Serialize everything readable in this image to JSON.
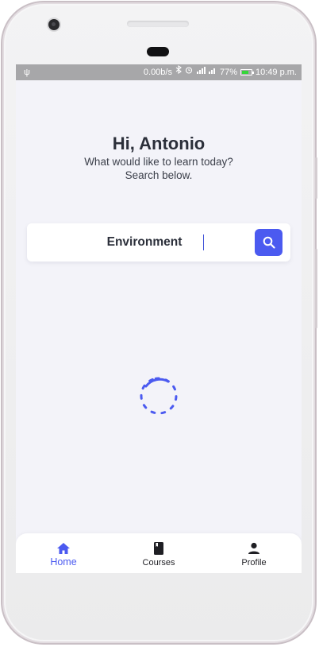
{
  "status_bar": {
    "usb_icon": "usb-icon",
    "network_speed": "0.00b/s",
    "battery_percent": "77%",
    "battery_level": 0.77,
    "battery_color": "#35d63a",
    "time": "10:49 p.m."
  },
  "header": {
    "greeting": "Hi, Antonio",
    "subtitle": "What would like to learn today? Search below."
  },
  "search": {
    "value": "Environment",
    "placeholder": "",
    "button_icon": "search-icon"
  },
  "loading": {
    "spinner_icon": "loading-spinner-icon"
  },
  "bottom_nav": {
    "items": [
      {
        "label": "Home",
        "icon": "home-icon",
        "active": true
      },
      {
        "label": "Courses",
        "icon": "book-icon",
        "active": false
      },
      {
        "label": "Profile",
        "icon": "person-icon",
        "active": false
      }
    ]
  },
  "colors": {
    "accent": "#4b5af0",
    "background": "#f3f3f9",
    "text": "#2b2f3a"
  }
}
